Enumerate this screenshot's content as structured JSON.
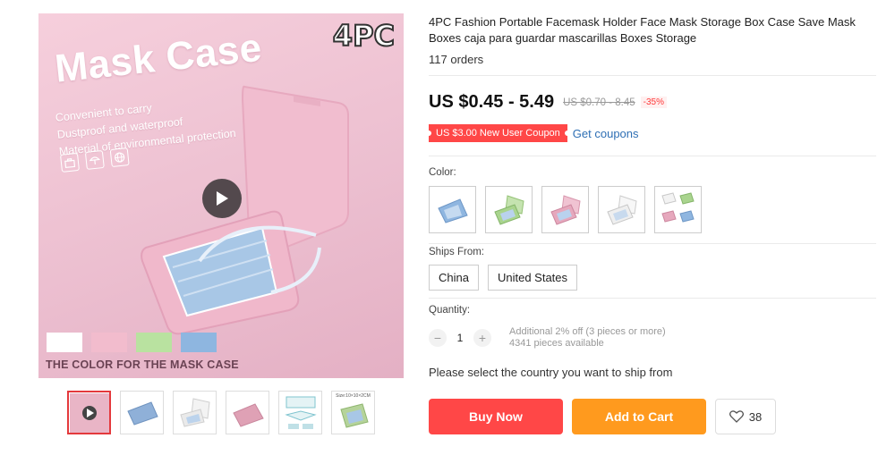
{
  "gallery": {
    "image_title": "Mask Case",
    "features": [
      "Convenient to carry",
      "Dustproof and waterproof",
      "Material of environmental protection"
    ],
    "badge": "4PC",
    "caption": "THE COLOR FOR THE MASK CASE",
    "swatch_colors": [
      "#ffffff",
      "#f2bccd",
      "#b9e2a0",
      "#8eb6e0"
    ],
    "thumbnails": [
      {
        "icon": "play-icon",
        "color": "#e9b5c6"
      },
      {
        "icon": "mask-case-blue",
        "color": "#8fb0d8"
      },
      {
        "icon": "mask-case-white",
        "color": "#eeeeee"
      },
      {
        "icon": "mask-case-pink",
        "color": "#dfa1b5"
      },
      {
        "icon": "mask-case-diagram",
        "color": "#bfe0e6"
      },
      {
        "icon": "mask-case-green",
        "color": "#b5d39a",
        "label": "Size:10×10×2CM"
      }
    ]
  },
  "product": {
    "title": "4PC Fashion Portable Facemask Holder Face Mask Storage Box Case Save Mask Boxes caja para guardar mascarillas Boxes Storage",
    "orders": "117 orders",
    "price": "US $0.45 - 5.49",
    "old_price": "US $0.70 - 8.45",
    "discount": "-35%",
    "coupon": "US $3.00 New User Coupon",
    "get_coupons": "Get coupons",
    "color_label": "Color:",
    "color_options": [
      {
        "icon": "blue-case",
        "color": "#8fb6e0"
      },
      {
        "icon": "green-case",
        "color": "#a9d48e"
      },
      {
        "icon": "pink-case",
        "color": "#e6a8bd"
      },
      {
        "icon": "white-case",
        "color": "#e8e8e8"
      },
      {
        "icon": "mixed-cases",
        "color": "#c6c6c6"
      }
    ],
    "ships_from_label": "Ships From:",
    "ships_from": [
      "China",
      "United States"
    ],
    "quantity_label": "Quantity:",
    "quantity": "1",
    "qty_minus": "−",
    "qty_plus": "+",
    "qty_offer": "Additional 2% off (3 pieces or more)",
    "qty_available": "4341 pieces available",
    "ship_message": "Please select the country you want to ship from",
    "buy_now": "Buy Now",
    "add_to_cart": "Add to Cart",
    "wishlist_count": "38"
  },
  "colors": {
    "price_red": "#ff4747",
    "cart_orange": "#ff9a1e",
    "link_blue": "#2e6fb4"
  }
}
